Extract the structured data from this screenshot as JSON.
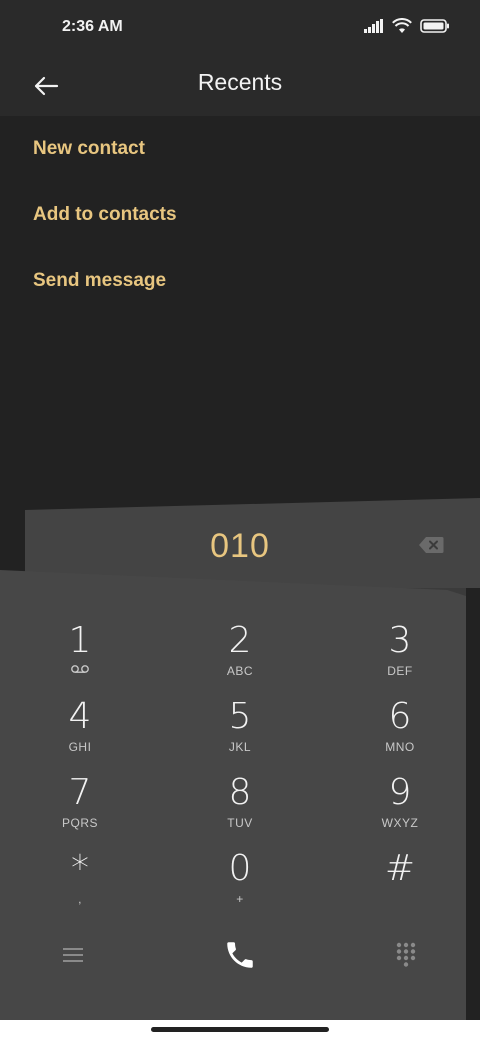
{
  "status_bar": {
    "time": "2:36 AM"
  },
  "header": {
    "title": "Recents"
  },
  "menu": {
    "items": [
      {
        "label": "New contact"
      },
      {
        "label": "Add to contacts"
      },
      {
        "label": "Send message"
      }
    ]
  },
  "dialer": {
    "number": "010",
    "keys": [
      {
        "digit": "1",
        "letters": ""
      },
      {
        "digit": "2",
        "letters": "ABC"
      },
      {
        "digit": "3",
        "letters": "DEF"
      },
      {
        "digit": "4",
        "letters": "GHI"
      },
      {
        "digit": "5",
        "letters": "JKL"
      },
      {
        "digit": "6",
        "letters": "MNO"
      },
      {
        "digit": "7",
        "letters": "PQRS"
      },
      {
        "digit": "8",
        "letters": "TUV"
      },
      {
        "digit": "9",
        "letters": "WXYZ"
      },
      {
        "digit": "*",
        "letters": ","
      },
      {
        "digit": "0",
        "letters": "+"
      },
      {
        "digit": "#",
        "letters": ""
      }
    ]
  },
  "icons": {
    "back": "back-arrow-icon",
    "backspace": "backspace-icon",
    "voicemail": "voicemail-icon",
    "menu": "menu-icon",
    "call": "phone-icon",
    "dialpad": "dialpad-icon"
  },
  "colors": {
    "accent": "#e8c680",
    "background": "#222222",
    "keypad": "#474747"
  }
}
